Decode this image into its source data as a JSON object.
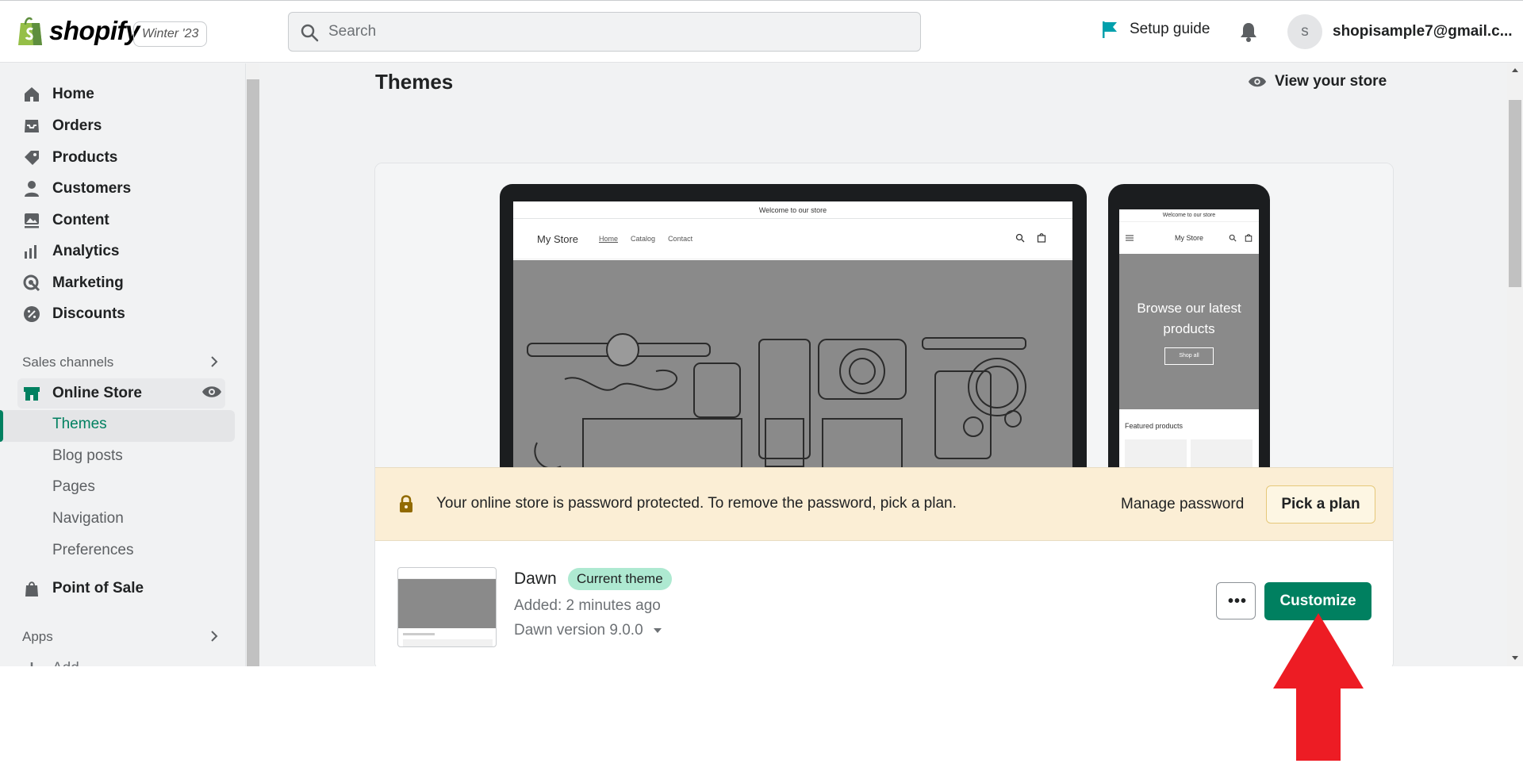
{
  "topbar": {
    "logo_text": "shopify",
    "edition": "Winter '23",
    "search_placeholder": "Search",
    "setup_guide": "Setup guide",
    "avatar_initial": "s",
    "email": "shopisample7@gmail.c..."
  },
  "sidebar": {
    "items": [
      {
        "label": "Home",
        "icon": "home-icon"
      },
      {
        "label": "Orders",
        "icon": "orders-icon"
      },
      {
        "label": "Products",
        "icon": "tag-icon"
      },
      {
        "label": "Customers",
        "icon": "person-icon"
      },
      {
        "label": "Content",
        "icon": "image-icon"
      },
      {
        "label": "Analytics",
        "icon": "bar-chart-icon"
      },
      {
        "label": "Marketing",
        "icon": "target-icon"
      },
      {
        "label": "Discounts",
        "icon": "discount-icon"
      }
    ],
    "sales_channels": "Sales channels",
    "online_store": "Online Store",
    "subitems": [
      "Themes",
      "Blog posts",
      "Pages",
      "Navigation",
      "Preferences"
    ],
    "point_of_sale": "Point of Sale",
    "apps": "Apps",
    "add_apps": "Add"
  },
  "main": {
    "title": "Themes",
    "view_store": "View your store",
    "preview": {
      "announcement": "Welcome to our store",
      "store_name": "My Store",
      "nav": [
        "Home",
        "Catalog",
        "Contact"
      ],
      "hero_text": "Browse our latest products",
      "shop_all": "Shop all",
      "featured": "Featured products"
    },
    "banner": {
      "message": "Your online store is password protected. To remove the password, pick a plan.",
      "manage": "Manage password",
      "pick_plan": "Pick a plan"
    },
    "theme": {
      "name": "Dawn",
      "badge": "Current theme",
      "added": "Added: 2 minutes ago",
      "version": "Dawn version 9.0.0",
      "more": "•••",
      "customize": "Customize"
    }
  },
  "colors": {
    "accent": "#008060",
    "arrow": "#ed1c24",
    "banner": "#fbeed5",
    "badge": "#aee9d1"
  }
}
